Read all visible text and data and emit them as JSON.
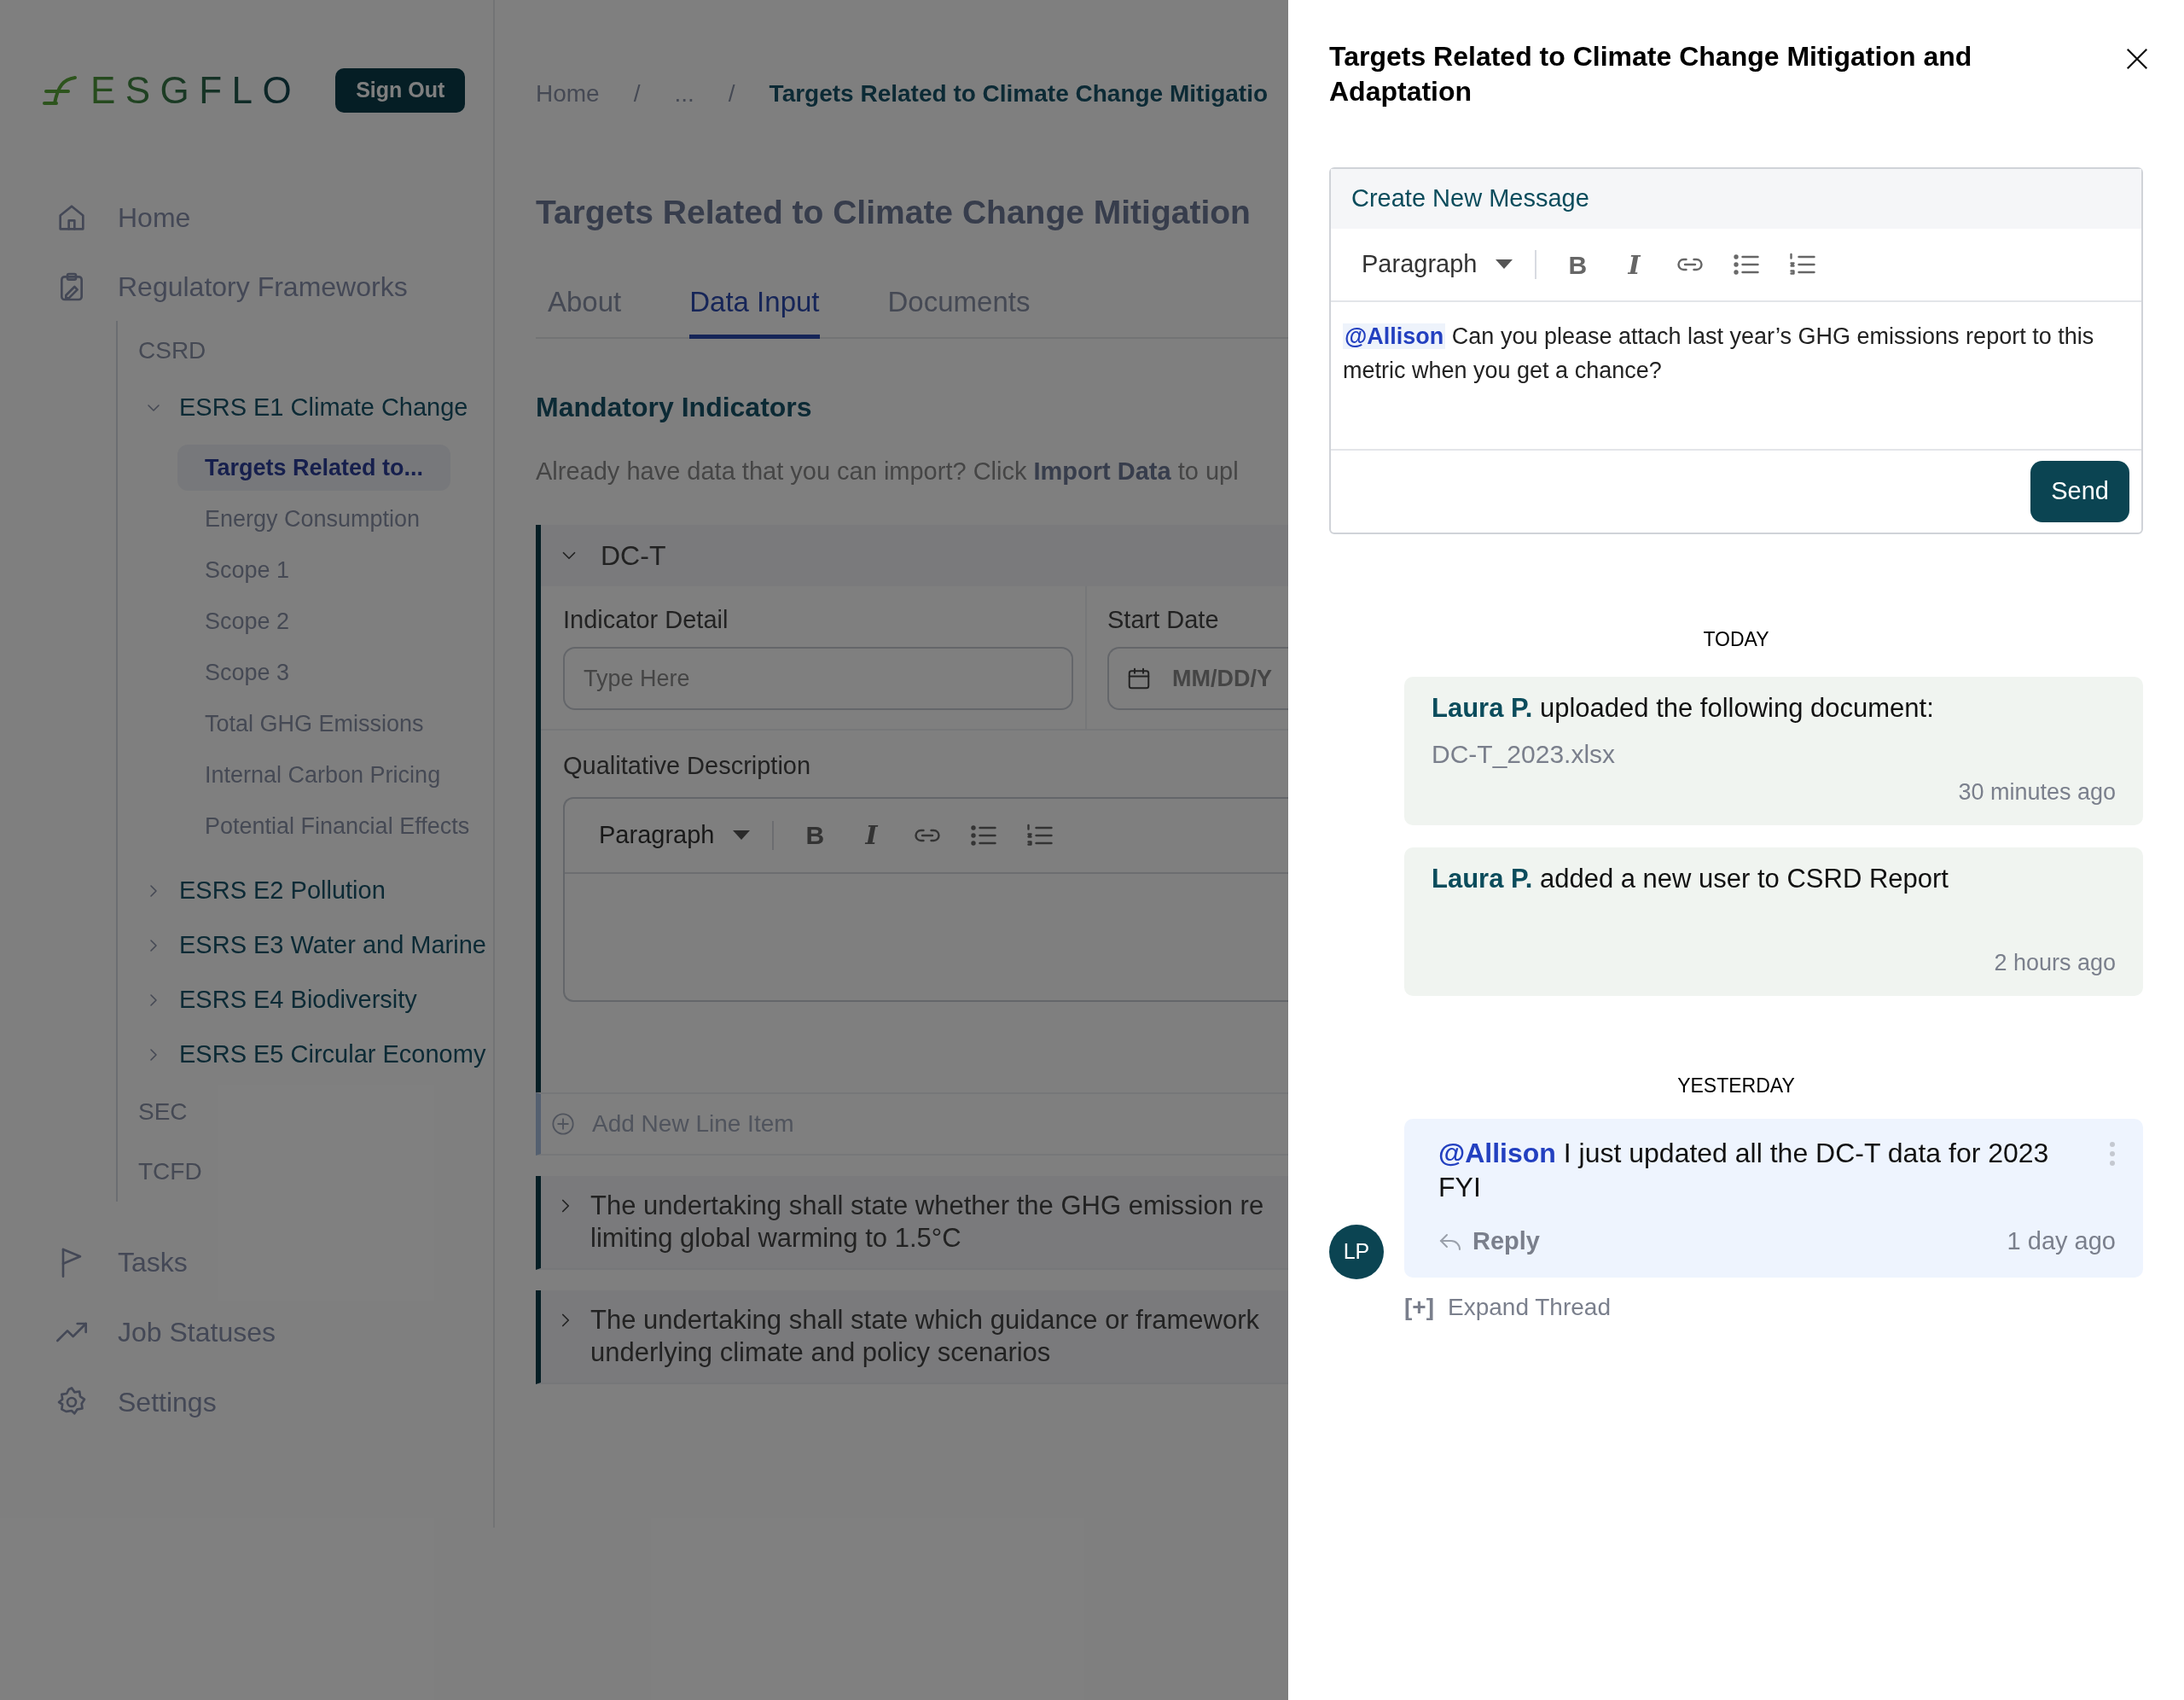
{
  "sidebar": {
    "logo": "ESGFLO",
    "sign_out": "Sign Out",
    "nav": [
      {
        "label": "Home"
      },
      {
        "label": "Regulatory Frameworks",
        "children": [
          {
            "label": "CSRD",
            "children": [
              {
                "label": "ESRS E1 Climate Change",
                "expanded": true,
                "children": [
                  {
                    "label": "Targets Related to...",
                    "selected": true
                  },
                  {
                    "label": "Energy Consumption",
                    "selected": false
                  },
                  {
                    "label": "Scope 1",
                    "selected": false
                  },
                  {
                    "label": "Scope 2",
                    "selected": false
                  },
                  {
                    "label": "Scope 3",
                    "selected": false
                  },
                  {
                    "label": "Total GHG Emissions",
                    "selected": false
                  },
                  {
                    "label": "Internal Carbon Pricing",
                    "selected": false
                  },
                  {
                    "label": "Potential Financial Effects",
                    "selected": false
                  }
                ]
              },
              {
                "label": "ESRS E2 Pollution",
                "expanded": false
              },
              {
                "label": "ESRS E3 Water and Marine",
                "expanded": false
              },
              {
                "label": "ESRS E4 Biodiversity",
                "expanded": false
              },
              {
                "label": "ESRS E5 Circular Economy",
                "expanded": false
              }
            ]
          },
          {
            "label": "SEC"
          },
          {
            "label": "TCFD"
          }
        ]
      },
      {
        "label": "Tasks"
      },
      {
        "label": "Job Statuses"
      },
      {
        "label": "Settings"
      }
    ]
  },
  "breadcrumb": {
    "items": [
      "Home",
      "...",
      "Targets Related to Climate Change Mitigatio"
    ],
    "separators": [
      "/",
      "/"
    ]
  },
  "page_title": "Targets Related to Climate Change Mitigation",
  "tabs": [
    {
      "label": "About",
      "selected": false
    },
    {
      "label": "Data Input",
      "selected": true
    },
    {
      "label": "Documents",
      "selected": false
    }
  ],
  "section_title": "Mandatory Indicators",
  "import_hint": "Already have data that you can import? Click **Import Data** to upl",
  "indicator": {
    "title": "DC-T",
    "expanded": true,
    "detail_label": "Indicator Detail",
    "detail_placeholder": "Type Here",
    "date_label": "Start Date",
    "date_placeholder": "MM/DD/Y",
    "description_label": "Qualitative Description",
    "toolbar": {
      "format": "Paragraph",
      "bold": "B",
      "italic": "I"
    },
    "add_item": "Add New Line Item"
  },
  "accordions": [
    {
      "lines": [
        "The undertaking shall state whether the GHG emission re",
        "limiting global warming to 1.5°C"
      ],
      "expanded": false
    },
    {
      "lines": [
        "The undertaking shall state which guidance or framework",
        "underlying climate and policy scenarios"
      ],
      "expanded": false
    }
  ],
  "panel": {
    "title": "Targets Related to Climate Change Mitigation and Adaptation",
    "composer": {
      "header": "Create New Message",
      "toolbar": {
        "format": "Paragraph",
        "bold": "B",
        "italic": "I"
      },
      "text": "**@Allison** Can you please attach last year’s GHG emissions report to this metric when you get a chance?",
      "send": "Send"
    },
    "groups": [
      {
        "label": "TODAY",
        "items": [
          {
            "kind": "activity",
            "text": "**Laura P.** uploaded the following document:",
            "file": "DC-T_2023.xlsx",
            "time": "30 minutes ago"
          },
          {
            "kind": "activity",
            "text": "**Laura P.** added a new user to CSRD Report",
            "time": "2 hours ago"
          }
        ]
      },
      {
        "label": "YESTERDAY",
        "items": [
          {
            "kind": "comment",
            "avatar": "LP",
            "text": "**@Allison** I just updated all the DC-T data for 2023 FYI",
            "reply": "Reply",
            "time": "1 day ago",
            "expand_mark": "[+]",
            "expand": "Expand Thread"
          }
        ]
      }
    ]
  }
}
